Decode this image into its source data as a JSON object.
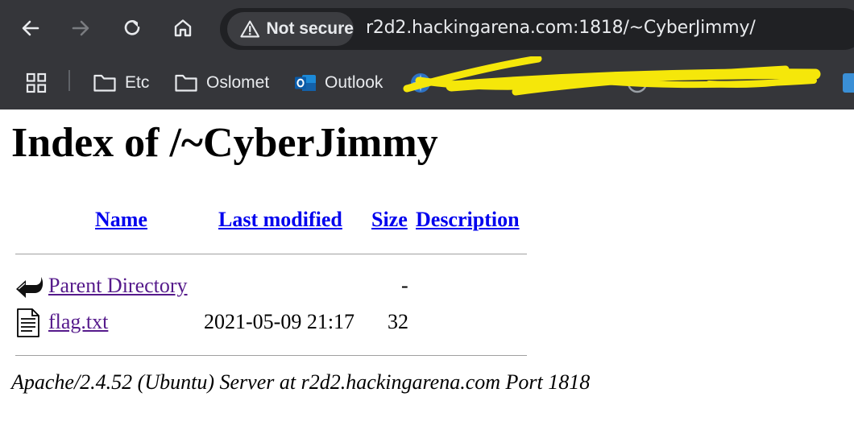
{
  "browser": {
    "security_label": "Not secure",
    "url": "r2d2.hackingarena.com:1818/~CyberJimmy/",
    "bookmarks": [
      {
        "label": "Etc",
        "icon": "folder-icon"
      },
      {
        "label": "Oslomet",
        "icon": "folder-icon"
      },
      {
        "label": "Outlook",
        "icon": "outlook-icon"
      }
    ]
  },
  "page": {
    "title": "Index of /~CyberJimmy",
    "columns": {
      "name": "Name",
      "last_modified": "Last modified",
      "size": "Size",
      "description": "Description"
    },
    "rows": [
      {
        "icon": "back-arrow-icon",
        "name": "Parent Directory",
        "last_modified": "",
        "size": "-",
        "description": ""
      },
      {
        "icon": "text-file-icon",
        "name": "flag.txt",
        "last_modified": "2021-05-09 21:17",
        "size": "32",
        "description": ""
      }
    ],
    "server_signature": "Apache/2.4.52 (Ubuntu) Server at r2d2.hackingarena.com Port 1818"
  },
  "colors": {
    "chrome_bg": "#35363a",
    "omnibox_bg": "#202124",
    "link": "#0000ee",
    "visited_link": "#551a8b",
    "redaction": "#f5e70a"
  }
}
